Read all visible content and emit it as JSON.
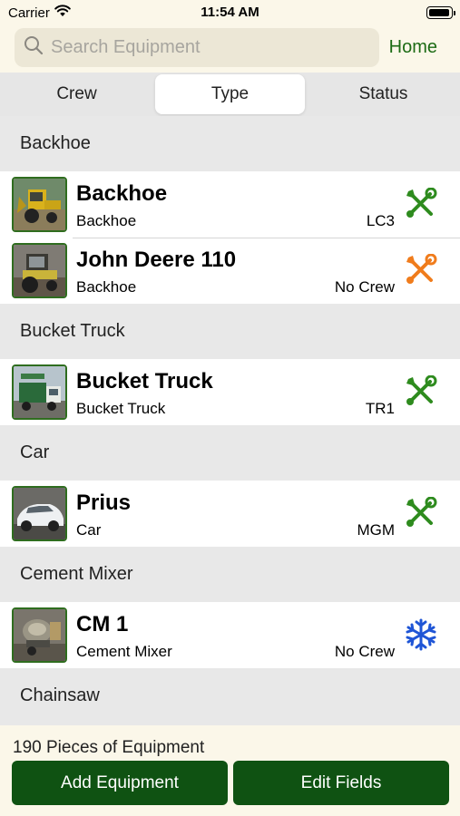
{
  "status_bar": {
    "carrier": "Carrier",
    "time": "11:54 AM"
  },
  "search": {
    "placeholder": "Search Equipment",
    "value": ""
  },
  "home_label": "Home",
  "segments": [
    {
      "label": "Crew",
      "selected": false
    },
    {
      "label": "Type",
      "selected": true
    },
    {
      "label": "Status",
      "selected": false
    }
  ],
  "sections": [
    {
      "header": "Backhoe",
      "items": [
        {
          "title": "Backhoe",
          "type": "Backhoe",
          "crew": "LC3",
          "status_icon": "wrench-screwdriver-icon",
          "status_color": "#2e8b1e"
        },
        {
          "title": "John Deere 110",
          "type": "Backhoe",
          "crew": "No Crew",
          "status_icon": "wrench-screwdriver-icon",
          "status_color": "#f07c1c"
        }
      ]
    },
    {
      "header": "Bucket Truck",
      "items": [
        {
          "title": "Bucket Truck",
          "type": "Bucket Truck",
          "crew": "TR1",
          "status_icon": "wrench-screwdriver-icon",
          "status_color": "#2e8b1e"
        }
      ]
    },
    {
      "header": "Car",
      "items": [
        {
          "title": "Prius",
          "type": "Car",
          "crew": "MGM",
          "status_icon": "wrench-screwdriver-icon",
          "status_color": "#2e8b1e"
        }
      ]
    },
    {
      "header": "Cement Mixer",
      "items": [
        {
          "title": "CM 1",
          "type": "Cement Mixer",
          "crew": "No Crew",
          "status_icon": "snowflake-icon",
          "status_color": "#1f55d6"
        }
      ]
    },
    {
      "header": "Chainsaw",
      "items": []
    }
  ],
  "footer": {
    "count": "190 Pieces of Equipment",
    "add_label": "Add Equipment",
    "edit_label": "Edit Fields"
  },
  "colors": {
    "accent": "#0f5212",
    "home_link": "#1c6b14",
    "header_bg": "#fbf7e9",
    "thumb_border": "#2f6d1f"
  }
}
